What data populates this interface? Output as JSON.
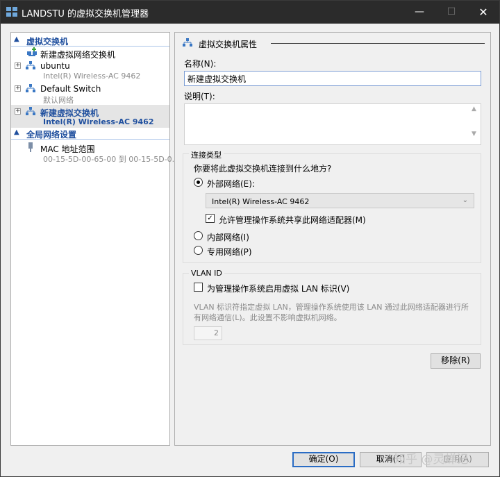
{
  "window": {
    "title": "LANDSTU 的虚拟交换机管理器",
    "minimize_glyph": "—",
    "maximize_glyph": "☐",
    "close_glyph": "✕"
  },
  "tree": {
    "section_switches": "虚拟交换机",
    "new_switch_action": "新建虚拟网络交换机",
    "switches": [
      {
        "name": "ubuntu",
        "detail": "Intel(R) Wireless-AC 9462"
      },
      {
        "name": "Default Switch",
        "detail": "默认网络"
      },
      {
        "name": "新建虚拟交换机",
        "detail": "Intel(R) Wireless-AC 9462"
      }
    ],
    "section_global": "全局网络设置",
    "mac_range": {
      "name": "MAC 地址范围",
      "detail": "00-15-5D-00-65-00 到 00-15-5D-0..."
    }
  },
  "props": {
    "header": "虚拟交换机属性",
    "name_label": "名称(N):",
    "name_value": "新建虚拟交换机",
    "notes_label": "说明(T):",
    "connection_type": {
      "title": "连接类型",
      "question": "你要将此虚拟交换机连接到什么地方?",
      "external_label": "外部网络(E):",
      "adapter_selected": "Intel(R) Wireless-AC 9462",
      "allow_share_label": "允许管理操作系统共享此网络适配器(M)",
      "internal_label": "内部网络(I)",
      "private_label": "专用网络(P)"
    },
    "vlan": {
      "title": "VLAN ID",
      "enable_label": "为管理操作系统启用虚拟 LAN 标识(V)",
      "description": "VLAN 标识符指定虚拟 LAN，管理操作系统使用该 LAN 通过此网络适配器进行所有网络通信(L)。此设置不影响虚拟机网络。",
      "value": "2"
    },
    "remove_button": "移除(R)"
  },
  "footer": {
    "ok_button": "确定(O)",
    "cancel_button": "取消(C)",
    "apply_button": "应用(A)"
  },
  "watermark": "知乎 @灵蝉记",
  "colors": {
    "titlebar": "#2b2b2b",
    "accent": "#1f4f9e",
    "selection": "#e5e5e5",
    "default_button_border": "#2a6cc4"
  }
}
